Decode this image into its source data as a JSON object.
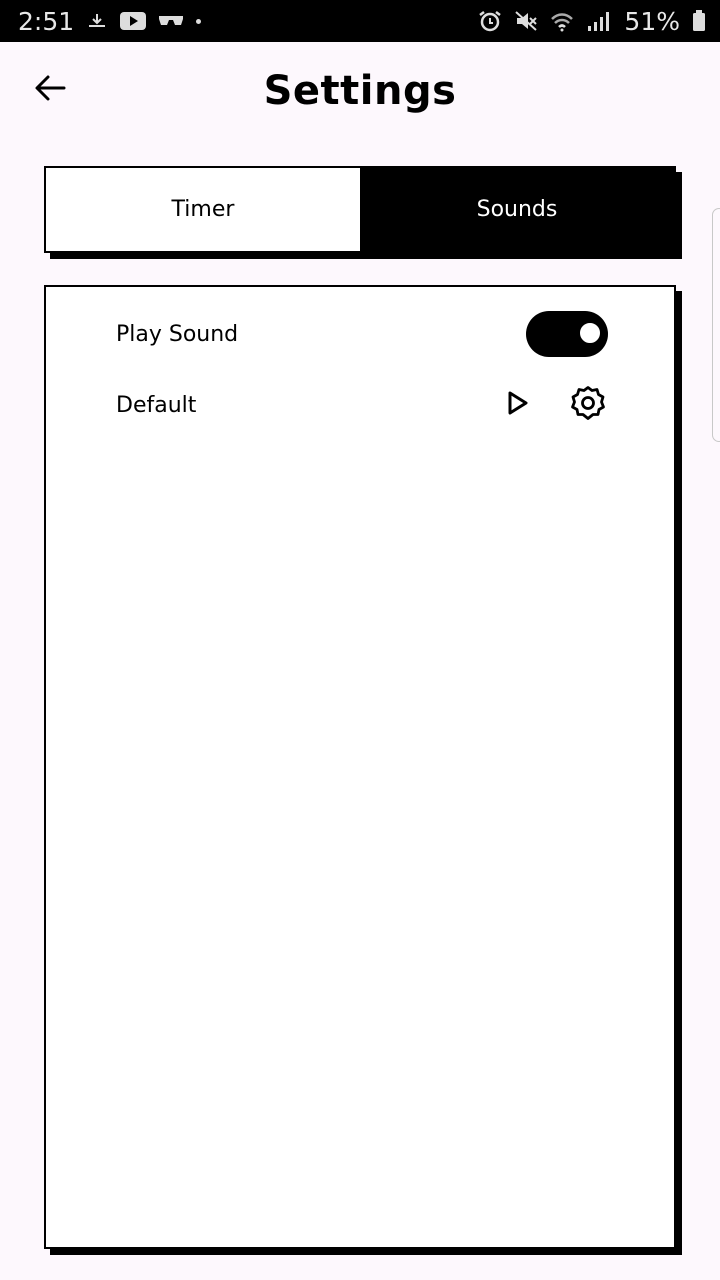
{
  "status_bar": {
    "time": "2:51",
    "battery": "51%",
    "icons": [
      "download-icon",
      "youtube-icon",
      "glasses-icon",
      "alarm-icon",
      "mute-icon",
      "wifi-icon",
      "signal-icon",
      "battery-icon"
    ]
  },
  "header": {
    "title": "Settings",
    "back_icon": "arrow-left-icon"
  },
  "tabs": [
    {
      "label": "Timer",
      "active": false
    },
    {
      "label": "Sounds",
      "active": true
    }
  ],
  "sounds": {
    "play_sound": {
      "label": "Play Sound",
      "enabled": true
    },
    "default_sound": {
      "label": "Default",
      "play_icon": "play-icon",
      "settings_icon": "gear-icon"
    }
  },
  "colors": {
    "background": "#fdf8fd",
    "accent": "#000000",
    "surface": "#ffffff"
  }
}
